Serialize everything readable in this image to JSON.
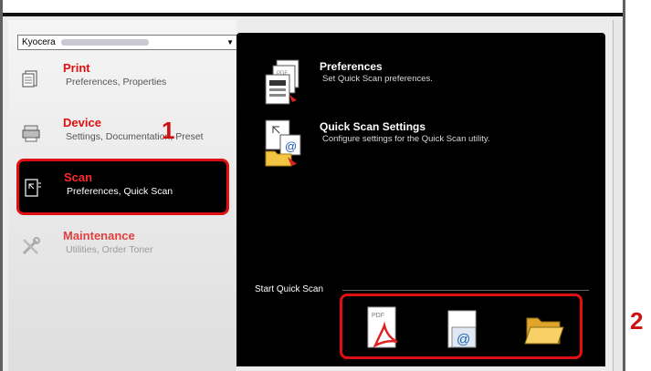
{
  "printer_select": {
    "value": "Kyocera"
  },
  "sidebar": {
    "items": [
      {
        "title": "Print",
        "subtitle": "Preferences, Properties",
        "icon": "print-icon"
      },
      {
        "title": "Device",
        "subtitle": "Settings, Documentation, Preset",
        "icon": "device-icon"
      },
      {
        "title": "Scan",
        "subtitle": "Preferences, Quick Scan",
        "icon": "scan-icon",
        "selected": true
      },
      {
        "title": "Maintenance",
        "subtitle": "Utilities, Order Toner",
        "icon": "maintenance-icon"
      }
    ]
  },
  "main": {
    "actions": [
      {
        "title": "Preferences",
        "subtitle": "Set Quick Scan preferences.",
        "icon": "scan-preferences-icon"
      },
      {
        "title": "Quick Scan Settings",
        "subtitle": "Configure settings for the Quick Scan utility.",
        "icon": "quick-scan-settings-icon"
      }
    ],
    "quick_scan": {
      "label": "Start Quick Scan",
      "buttons": [
        {
          "icon": "pdf-file-icon",
          "pdf_text": "PDF"
        },
        {
          "icon": "email-icon",
          "at_text": "@"
        },
        {
          "icon": "folder-icon"
        }
      ]
    }
  },
  "callouts": {
    "one": "1",
    "two": "2"
  },
  "colors": {
    "accent_red": "#e01010",
    "panel_black": "#000000"
  }
}
